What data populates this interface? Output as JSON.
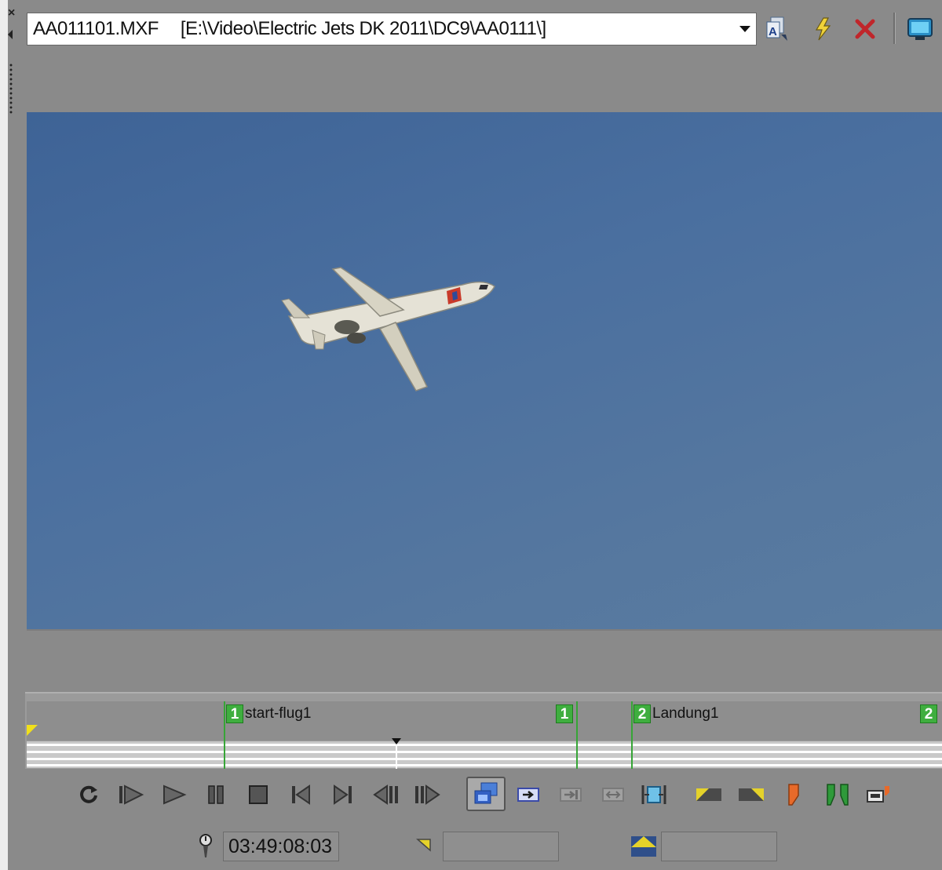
{
  "window": {
    "source_combo": {
      "filename": "AA011101.MXF",
      "path": "[E:\\Video\\Electric Jets DK 2011\\DC9\\AA0111\\]"
    },
    "toolbar_icons": [
      "media-properties-icon",
      "generate-media-icon",
      "delete-icon",
      "video-preview-icon"
    ]
  },
  "timeline": {
    "regions": [
      {
        "start_number": "1",
        "label": "start-flug1",
        "end_number": "1"
      },
      {
        "start_number": "2",
        "label": "Landung1",
        "end_number": "2"
      }
    ]
  },
  "transport": {
    "buttons": [
      "loop-icon",
      "play-from-start-icon",
      "play-icon",
      "pause-icon",
      "stop-icon",
      "go-to-start-icon",
      "go-to-end-icon",
      "previous-frame-icon",
      "next-frame-icon",
      "enable-scrub-icon",
      "create-subclip-icon",
      "add-to-timeline-end-icon",
      "add-to-timeline-fit-icon",
      "snap-icon",
      "mark-in-icon",
      "mark-out-icon",
      "marker-icon",
      "region-icon",
      "export-icon"
    ]
  },
  "status": {
    "timecode": "03:49:08:03",
    "selection_start": "",
    "selection_length": ""
  },
  "colors": {
    "region_green": "#3fae3f",
    "in_point_yellow": "#f1e01a",
    "panel_gray": "#8a8a8a"
  }
}
